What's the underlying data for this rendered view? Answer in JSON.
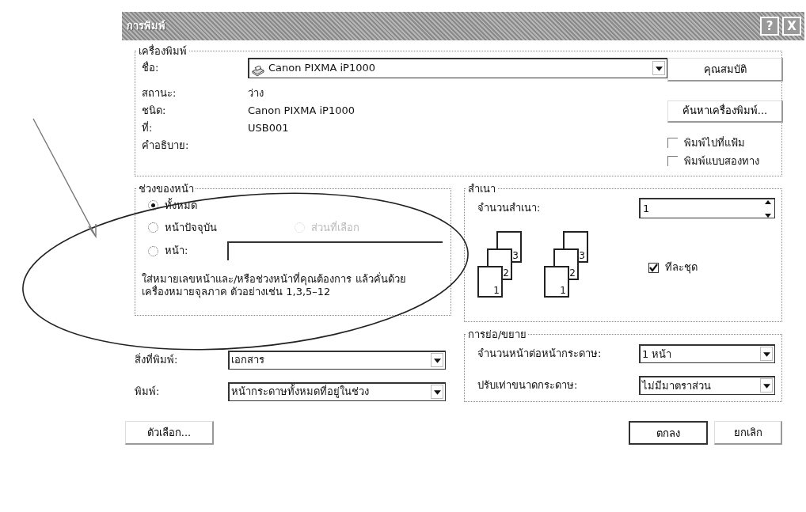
{
  "window": {
    "title": "การพิมพ์",
    "title_buttons": [
      "?",
      "X"
    ]
  },
  "printer": {
    "legend": "เครื่องพิมพ์",
    "name_label": "ชื่อ:",
    "name_value": "Canon PIXMA iP1000",
    "properties_button": "คุณสมบัติ",
    "find_button": "ค้นหาเครื่องพิมพ์...",
    "info": [
      {
        "label": "สถานะ:",
        "value": "ว่าง"
      },
      {
        "label": "ชนิด:",
        "value": "Canon PIXMA iP1000"
      },
      {
        "label": "ที่:",
        "value": "USB001"
      },
      {
        "label": "คำอธิบาย:"
      }
    ],
    "options": [
      {
        "label": "พิมพ์ไปที่แฟ้ม",
        "checked": false
      },
      {
        "label": "พิมพ์แบบสองทาง",
        "checked": false
      }
    ]
  },
  "page_range": {
    "legend": "ช่วงของหน้า",
    "choices": [
      {
        "label": "ทั้งหมด",
        "selected": true,
        "disabled": false
      },
      {
        "label": "หน้าปัจจุบัน",
        "selected": false,
        "disabled": false
      },
      {
        "label": "ส่วนที่เลือก",
        "selected": false,
        "disabled": true
      },
      {
        "label": "หน้า:",
        "selected": false,
        "disabled": false
      }
    ],
    "hint": "ใส่หมายเลขหน้าและ/หรือช่วงหน้าที่คุณต้องการ แล้วคั่นด้วยเครื่องหมายจุลภาค ตัวอย่างเช่น 1,3,5–12"
  },
  "copies": {
    "legend": "สำเนา",
    "count_label": "จำนวนสำเนา:",
    "count_value": "1",
    "stacks": [
      {
        "pages": [
          "1",
          "2",
          "3"
        ]
      },
      {
        "pages": [
          "1",
          "2",
          "3"
        ]
      }
    ],
    "collate": {
      "label": "ทีละชุด",
      "checked": true
    }
  },
  "print_what": [
    {
      "label": "สิ่งที่พิมพ์:",
      "value": "เอกสาร"
    },
    {
      "label": "พิมพ์:",
      "value": "หน้ากระดาษทั้งหมดที่อยู่ในช่วง"
    }
  ],
  "zoom": {
    "legend": "การย่อ/ขยาย",
    "rows": [
      {
        "label": "จำนวนหน้าต่อหน้ากระดาษ:",
        "value": "1 หน้า"
      },
      {
        "label": "ปรับเท่าขนาดกระดาษ:",
        "value": "ไม่มีมาตราส่วน"
      }
    ]
  },
  "buttons": {
    "options": "ตัวเลือก...",
    "ok": "ตกลง",
    "cancel": "ยกเลิก"
  }
}
